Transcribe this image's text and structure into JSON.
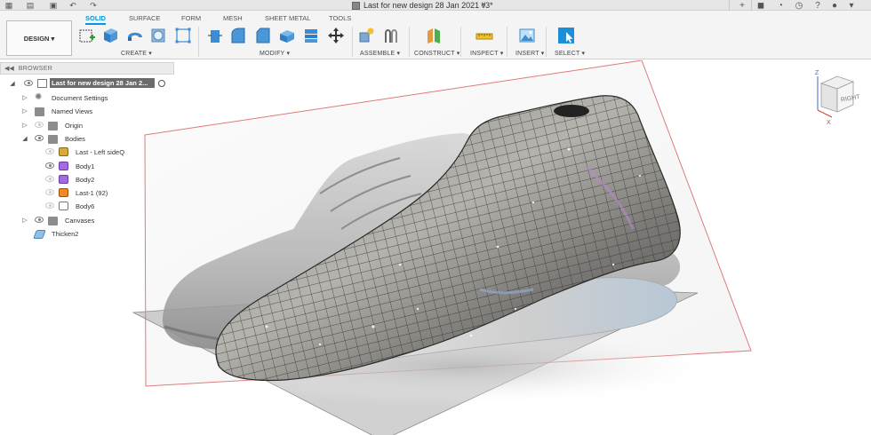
{
  "app": {
    "document_title": "Last for new design 28 Jan 2021 v3*",
    "close_glyph": "×"
  },
  "ribbon": {
    "tabs": [
      {
        "label": "SOLID",
        "active": true
      },
      {
        "label": "SURFACE",
        "active": false
      },
      {
        "label": "FORM",
        "active": false
      },
      {
        "label": "MESH",
        "active": false
      },
      {
        "label": "SHEET METAL",
        "active": false
      },
      {
        "label": "TOOLS",
        "active": false
      }
    ],
    "workspace_button": "DESIGN ▾",
    "groups": {
      "create": "CREATE ▾",
      "modify": "MODIFY ▾",
      "assemble": "ASSEMBLE ▾",
      "construct": "CONSTRUCT ▾",
      "inspect": "INSPECT ▾",
      "insert": "INSERT ▾",
      "select": "SELECT ▾"
    },
    "accent_color": "#0696d7"
  },
  "browser": {
    "header": "BROWSER",
    "root": "Last for new design 28 Jan 2...",
    "items": [
      {
        "label": "Document Settings",
        "icon": "gear-icon"
      },
      {
        "label": "Named Views",
        "icon": "folder-icon"
      },
      {
        "label": "Origin",
        "icon": "folder-icon"
      },
      {
        "label": "Bodies",
        "icon": "folder-icon"
      },
      {
        "label": "Last - Left sideQ",
        "icon": "body-icon-gold"
      },
      {
        "label": "Body1",
        "icon": "body-icon-purple"
      },
      {
        "label": "Body2",
        "icon": "body-icon-purple"
      },
      {
        "label": "Last-1 (92)",
        "icon": "body-icon-orange"
      },
      {
        "label": "Body6",
        "icon": "body-icon-outline"
      },
      {
        "label": "Canvases",
        "icon": "folder-icon"
      },
      {
        "label": "Thicken2",
        "icon": "thicken-icon"
      }
    ]
  },
  "viewcube": {
    "face_label": "RIGHT",
    "axis_z": "Z",
    "axis_x": "X"
  }
}
